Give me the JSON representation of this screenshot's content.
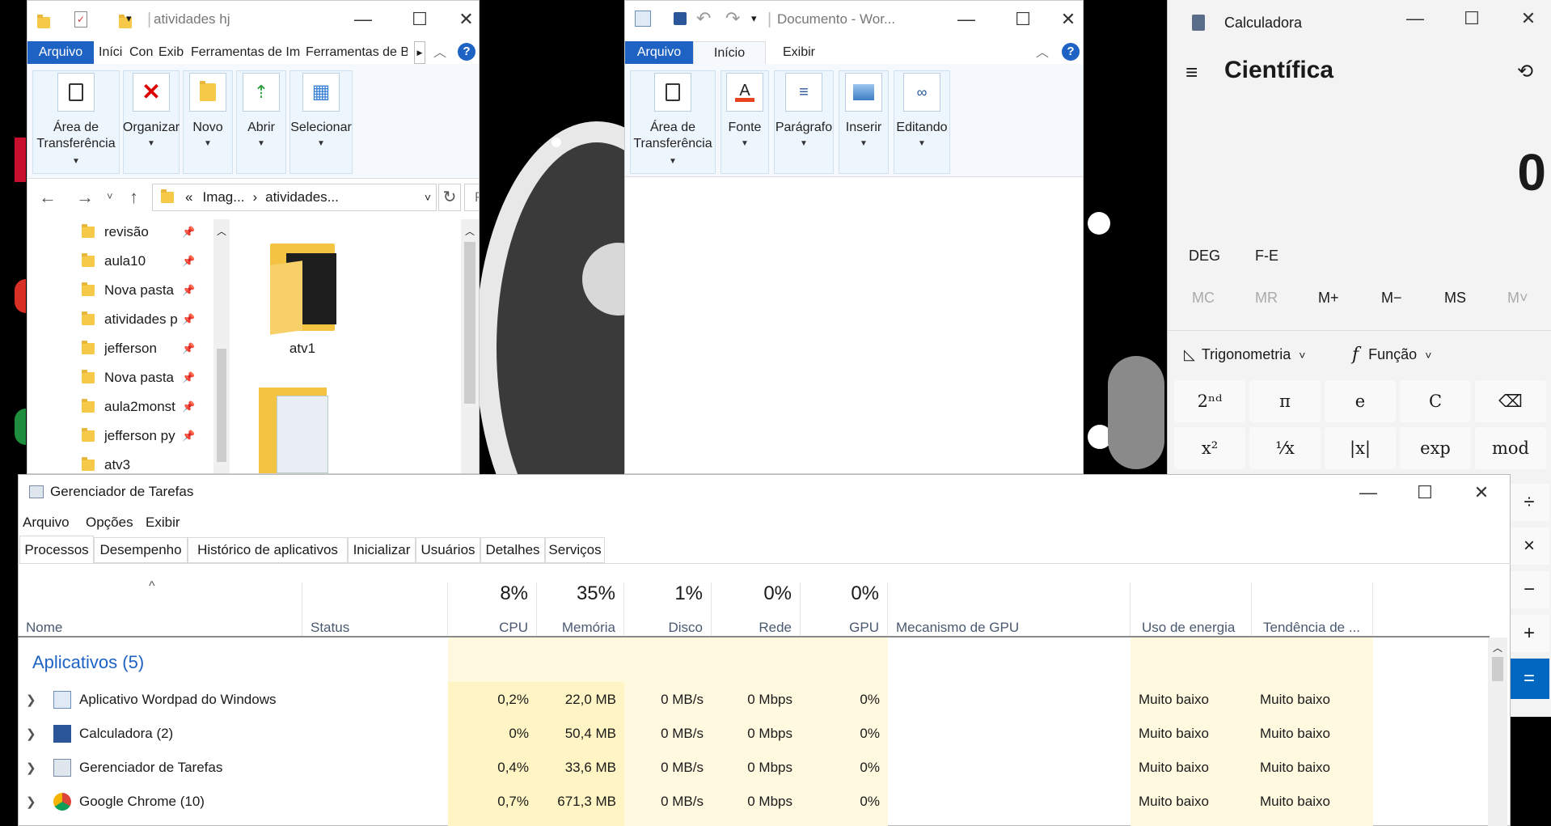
{
  "explorer": {
    "title": "atividades hj",
    "ribbon_tabs": [
      "Arquivo",
      "Iníci",
      "Con",
      "Exib",
      "Ferramentas de Im",
      "Ferramentas de Ba"
    ],
    "groups": [
      {
        "label_line1": "Área de",
        "label_line2": "Transferência",
        "icon": "clipboard-icon"
      },
      {
        "label_line1": "Organizar",
        "label_line2": "",
        "icon": "delete-x-icon"
      },
      {
        "label_line1": "Novo",
        "label_line2": "",
        "icon": "new-folder-icon"
      },
      {
        "label_line1": "Abrir",
        "label_line2": "",
        "icon": "open-icon"
      },
      {
        "label_line1": "Selecionar",
        "label_line2": "",
        "icon": "select-grid-icon"
      }
    ],
    "breadcrumb_prefix": "«",
    "breadcrumb_1": "Imag...",
    "breadcrumb_sep": "›",
    "breadcrumb_2": "atividades...",
    "search_placeholder": "Pesq",
    "nav_items": [
      "revisão",
      "aula10",
      "Nova pasta",
      "atividades p",
      "jefferson",
      "Nova pasta",
      "aula2monst",
      "jefferson py",
      "atv3"
    ],
    "file_1": "atv1"
  },
  "wordpad": {
    "title": "Documento - Wor...",
    "tabs": [
      "Arquivo",
      "Início",
      "Exibir"
    ],
    "groups": [
      {
        "label_line1": "Área de",
        "label_line2": "Transferência"
      },
      {
        "label_line1": "Fonte",
        "label_line2": ""
      },
      {
        "label_line1": "Parágrafo",
        "label_line2": ""
      },
      {
        "label_line1": "Inserir",
        "label_line2": ""
      },
      {
        "label_line1": "Editando",
        "label_line2": ""
      }
    ]
  },
  "calculator": {
    "title": "Calculadora",
    "mode": "Científica",
    "display": "0",
    "deg": "DEG",
    "fe": "F-E",
    "memory": [
      "MC",
      "MR",
      "M+",
      "M−",
      "MS",
      "M˅"
    ],
    "trig": "Trigonometria",
    "func": "Função",
    "f_glyph": "f",
    "row1": [
      "2ⁿᵈ",
      "π",
      "e",
      "C",
      "⌫"
    ],
    "row2": [
      "x²",
      "¹⁄x",
      "|x|",
      "exp",
      "mod"
    ],
    "side_ops": [
      "÷",
      "×",
      "−",
      "+",
      "="
    ]
  },
  "taskmgr": {
    "title": "Gerenciador de Tarefas",
    "menu": [
      "Arquivo",
      "Opções",
      "Exibir"
    ],
    "tabs": [
      "Processos",
      "Desempenho",
      "Histórico de aplicativos",
      "Inicializar",
      "Usuários",
      "Detalhes",
      "Serviços"
    ],
    "sort_arrow": "^",
    "columns": {
      "name": "Nome",
      "status": "Status",
      "cpu": "CPU",
      "mem": "Memória",
      "disk": "Disco",
      "net": "Rede",
      "gpu": "GPU",
      "gpu_engine": "Mecanismo de GPU",
      "power": "Uso de energia",
      "power_trend": "Tendência de ..."
    },
    "totals": {
      "cpu": "8%",
      "mem": "35%",
      "disk": "1%",
      "net": "0%",
      "gpu": "0%"
    },
    "group_label": "Aplicativos (5)",
    "rows": [
      {
        "name": "Aplicativo Wordpad do Windows",
        "cpu": "0,2%",
        "mem": "22,0 MB",
        "disk": "0 MB/s",
        "net": "0 Mbps",
        "gpu": "0%",
        "power": "Muito baixo",
        "trend": "Muito baixo",
        "icon": "wordpad-icon"
      },
      {
        "name": "Calculadora (2)",
        "cpu": "0%",
        "mem": "50,4 MB",
        "disk": "0 MB/s",
        "net": "0 Mbps",
        "gpu": "0%",
        "power": "Muito baixo",
        "trend": "Muito baixo",
        "icon": "calculator-icon"
      },
      {
        "name": "Gerenciador de Tarefas",
        "cpu": "0,4%",
        "mem": "33,6 MB",
        "disk": "0 MB/s",
        "net": "0 Mbps",
        "gpu": "0%",
        "power": "Muito baixo",
        "trend": "Muito baixo",
        "icon": "taskmgr-icon"
      },
      {
        "name": "Google Chrome (10)",
        "cpu": "0,7%",
        "mem": "671,3 MB",
        "disk": "0 MB/s",
        "net": "0 Mbps",
        "gpu": "0%",
        "power": "Muito baixo",
        "trend": "Muito baixo",
        "icon": "chrome-icon"
      }
    ]
  },
  "colors": {
    "accent": "#1e63c4",
    "heat_light": "#fff9e0",
    "heat_mid": "#fff4c4",
    "calc_equals": "#0067c0"
  }
}
